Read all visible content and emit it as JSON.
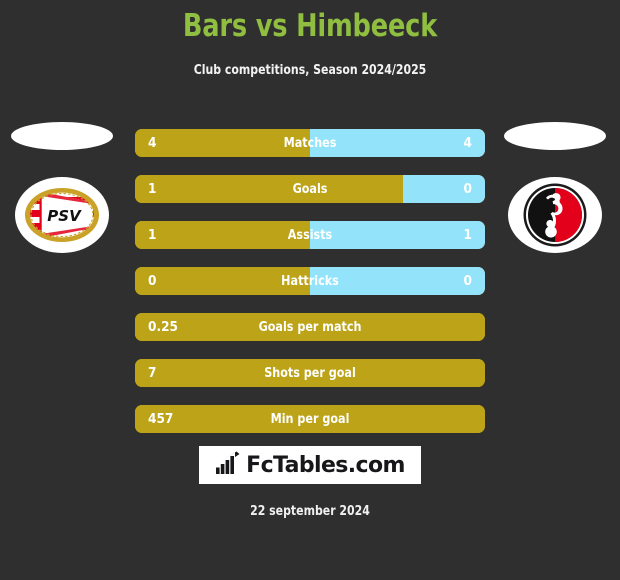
{
  "header": {
    "title": "Bars vs Himbeeck",
    "subtitle": "Club competitions, Season 2024/2025",
    "title_color": "#8FBE40"
  },
  "teams": {
    "home": {
      "name": "PSV",
      "badge_icon": "psv-crest-icon",
      "colors": [
        "#E2001A",
        "#FFFFFF",
        "#C9A227"
      ]
    },
    "away": {
      "name": "Himbeeck club",
      "badge_icon": "black-red-crest-icon",
      "colors": [
        "#111111",
        "#E2001A",
        "#FFFFFF"
      ]
    }
  },
  "colors": {
    "background": "#2f2f2f",
    "home_bar": "#BCA318",
    "away_bar": "#93E3FB",
    "text": "#FFFFFF"
  },
  "chart_data": {
    "type": "bar",
    "title": "Bars vs Himbeeck",
    "subtitle": "Club competitions, Season 2024/2025",
    "orientation": "horizontal-diverging",
    "legend_position": "none",
    "grid": false,
    "series": [
      {
        "name": "Bars",
        "color": "#BCA318"
      },
      {
        "name": "Himbeeck",
        "color": "#93E3FB"
      }
    ],
    "categories": [
      "Matches",
      "Goals",
      "Assists",
      "Hattricks",
      "Goals per match",
      "Shots per goal",
      "Min per goal"
    ],
    "rows": [
      {
        "label": "Matches",
        "home_value": "4",
        "away_value": "4",
        "home_pct": 50,
        "away_pct": 50,
        "split": true
      },
      {
        "label": "Goals",
        "home_value": "1",
        "away_value": "0",
        "home_pct": 76.5,
        "away_pct": 23.5,
        "split": true
      },
      {
        "label": "Assists",
        "home_value": "1",
        "away_value": "1",
        "home_pct": 50,
        "away_pct": 50,
        "split": true
      },
      {
        "label": "Hattricks",
        "home_value": "0",
        "away_value": "0",
        "home_pct": 50,
        "away_pct": 50,
        "split": true
      },
      {
        "label": "Goals per match",
        "home_value": "0.25",
        "away_value": "",
        "home_pct": 100,
        "away_pct": 0,
        "split": false
      },
      {
        "label": "Shots per goal",
        "home_value": "7",
        "away_value": "",
        "home_pct": 100,
        "away_pct": 0,
        "split": false
      },
      {
        "label": "Min per goal",
        "home_value": "457",
        "away_value": "",
        "home_pct": 100,
        "away_pct": 0,
        "split": false
      }
    ]
  },
  "footer": {
    "brand_text": "FcTables.com",
    "brand_icon": "bar-chart-arrow-icon",
    "date": "22 september 2024"
  }
}
